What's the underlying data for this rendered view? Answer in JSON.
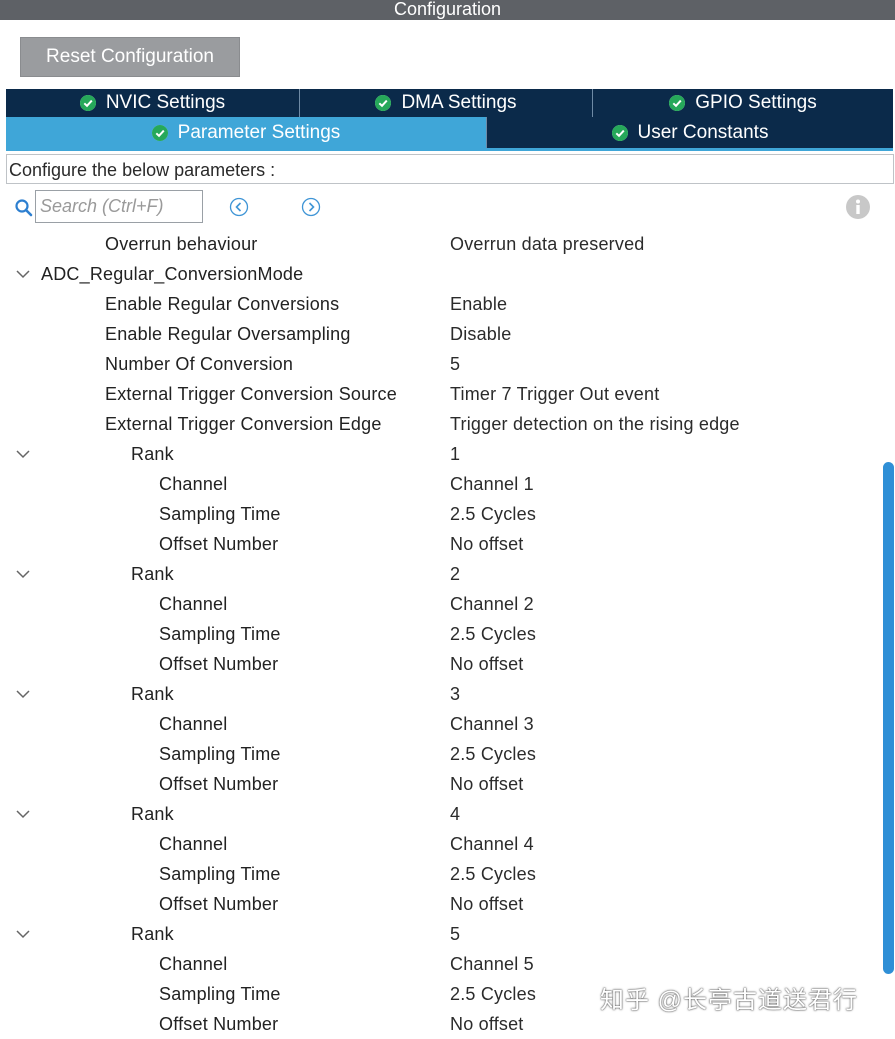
{
  "window": {
    "title": "Configuration"
  },
  "toolbar": {
    "reset_label": "Reset Configuration"
  },
  "tabs": {
    "row1": [
      {
        "label": "NVIC Settings",
        "icon": "check-circle-icon"
      },
      {
        "label": "DMA Settings",
        "icon": "check-circle-icon"
      },
      {
        "label": "GPIO Settings",
        "icon": "check-circle-icon"
      }
    ],
    "row2": [
      {
        "label": "Parameter Settings",
        "icon": "check-circle-icon",
        "active": true
      },
      {
        "label": "User Constants",
        "icon": "check-circle-icon"
      }
    ]
  },
  "colors": {
    "tab_bg": "#0b2a4a",
    "tab_active_bg": "#3fa6d8",
    "scrollbar": "#2f8fd6",
    "check_icon": "#26a85a"
  },
  "configure_text": "Configure the below parameters :",
  "search": {
    "placeholder": "Search (Ctrl+F)"
  },
  "params": {
    "overrun": {
      "label": "Overrun behaviour",
      "value": "Overrun data preserved"
    },
    "group_title": "ADC_Regular_ConversionMode",
    "enable_regular": {
      "label": "Enable Regular Conversions",
      "value": "Enable"
    },
    "enable_oversampling": {
      "label": "Enable Regular Oversampling",
      "value": "Disable"
    },
    "num_conversion": {
      "label": "Number Of Conversion",
      "value": "5"
    },
    "ext_trigger_source": {
      "label": "External Trigger Conversion Source",
      "value": "Timer 7 Trigger Out event"
    },
    "ext_trigger_edge": {
      "label": "External Trigger Conversion Edge",
      "value": "Trigger detection on the rising edge"
    },
    "ranks": [
      {
        "label": "Rank",
        "value": "1",
        "channel_label": "Channel",
        "channel": "Channel 1",
        "sampling_label": "Sampling Time",
        "sampling": "2.5 Cycles",
        "offset_label": "Offset Number",
        "offset": "No offset"
      },
      {
        "label": "Rank",
        "value": "2",
        "channel_label": "Channel",
        "channel": "Channel 2",
        "sampling_label": "Sampling Time",
        "sampling": "2.5 Cycles",
        "offset_label": "Offset Number",
        "offset": "No offset"
      },
      {
        "label": "Rank",
        "value": "3",
        "channel_label": "Channel",
        "channel": "Channel 3",
        "sampling_label": "Sampling Time",
        "sampling": "2.5 Cycles",
        "offset_label": "Offset Number",
        "offset": "No offset"
      },
      {
        "label": "Rank",
        "value": "4",
        "channel_label": "Channel",
        "channel": "Channel 4",
        "sampling_label": "Sampling Time",
        "sampling": "2.5 Cycles",
        "offset_label": "Offset Number",
        "offset": "No offset"
      },
      {
        "label": "Rank",
        "value": "5",
        "channel_label": "Channel",
        "channel": "Channel 5",
        "sampling_label": "Sampling Time",
        "sampling": "2.5 Cycles",
        "offset_label": "Offset Number",
        "offset": "No offset"
      }
    ]
  },
  "watermark": "知乎 @长亭古道送君行"
}
